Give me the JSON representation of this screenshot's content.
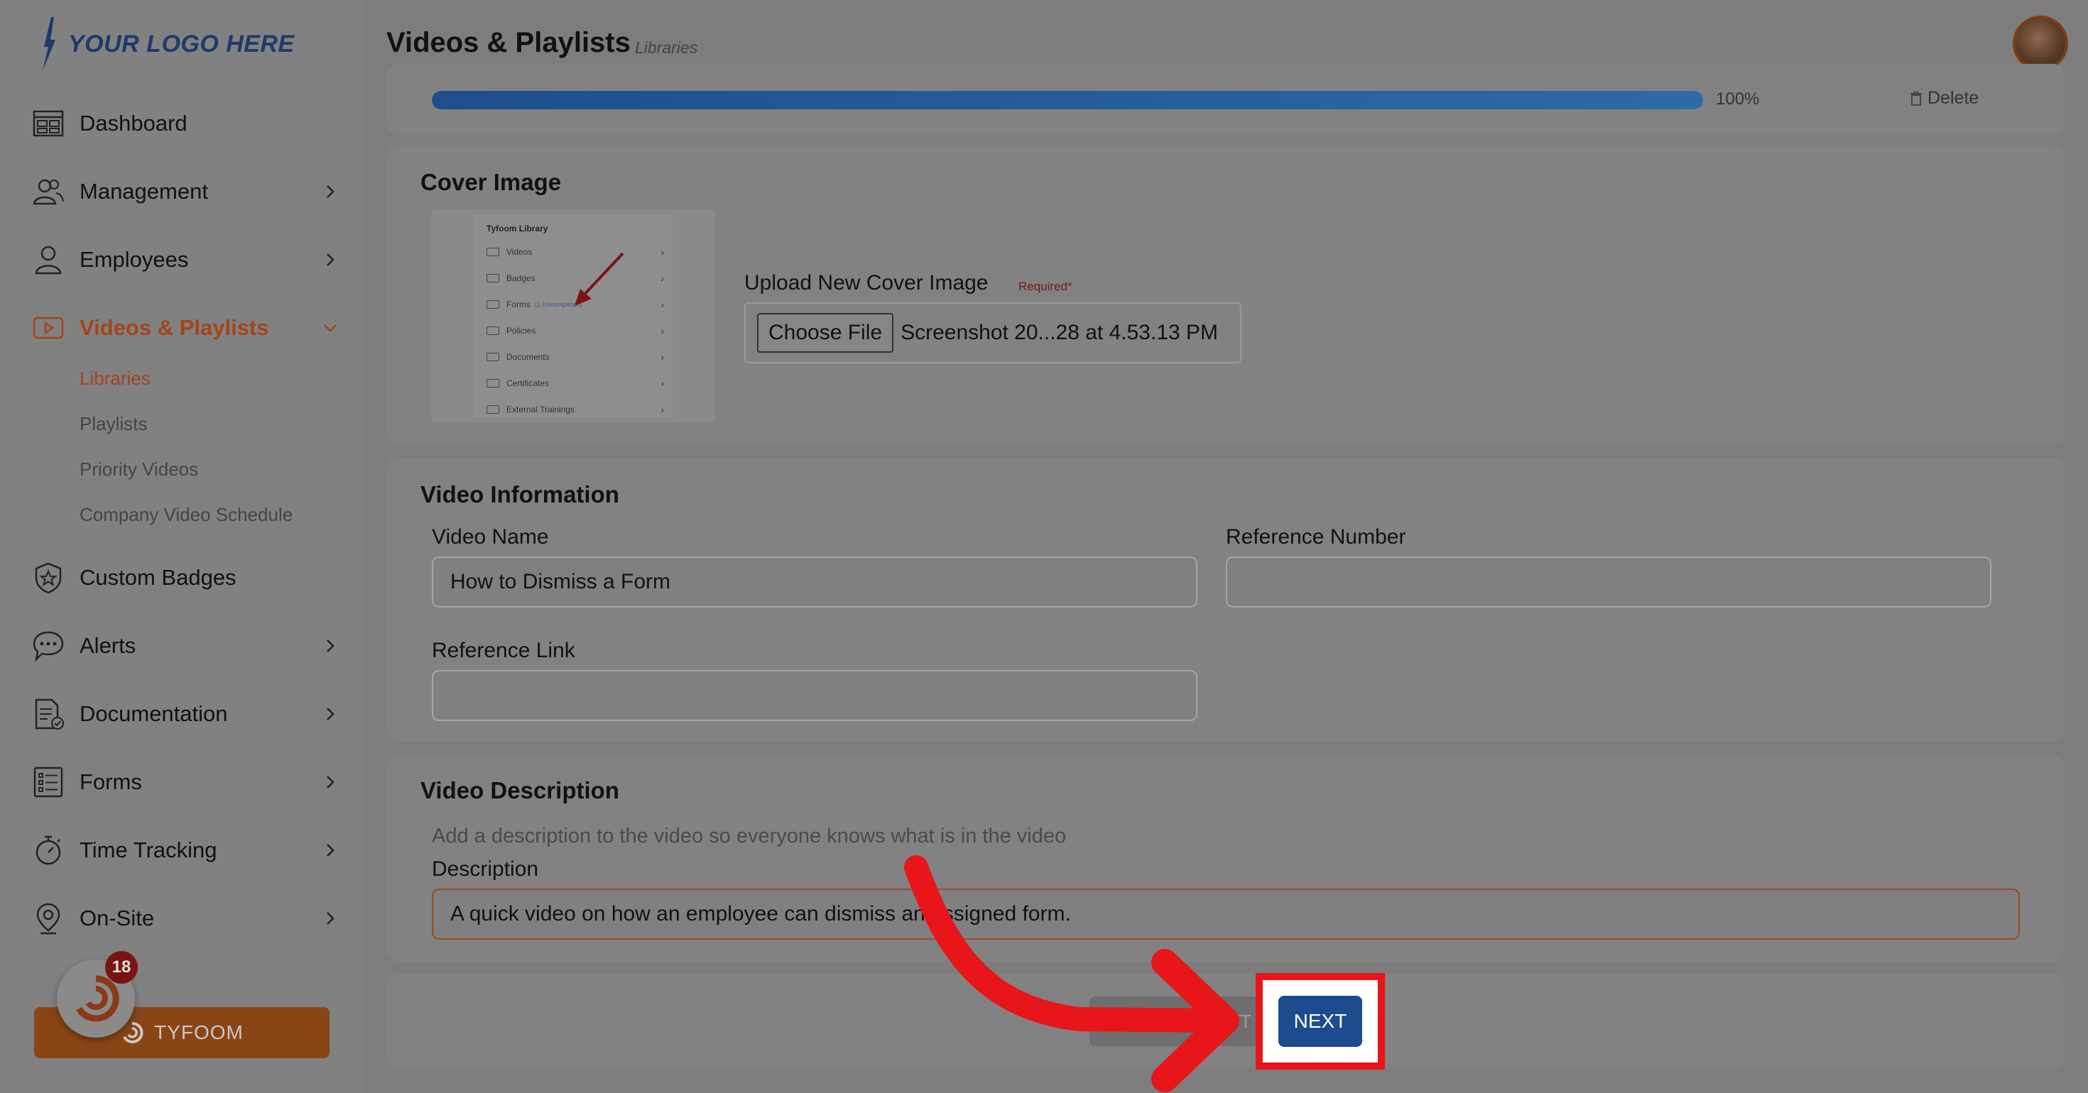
{
  "logo": {
    "text": "YOUR LOGO HERE"
  },
  "header": {
    "title": "Videos & Playlists",
    "breadcrumb": "Libraries"
  },
  "sidebar": {
    "items": [
      {
        "label": "Dashboard",
        "icon": "dashboard-icon",
        "chevron": false
      },
      {
        "label": "Management",
        "icon": "management-icon",
        "chevron": true
      },
      {
        "label": "Employees",
        "icon": "employees-icon",
        "chevron": true
      },
      {
        "label": "Videos & Playlists",
        "icon": "video-icon",
        "chevron": true,
        "active": true,
        "expanded": true
      },
      {
        "label": "Custom Badges",
        "icon": "badge-icon",
        "chevron": false
      },
      {
        "label": "Alerts",
        "icon": "alerts-icon",
        "chevron": true
      },
      {
        "label": "Documentation",
        "icon": "documentation-icon",
        "chevron": true
      },
      {
        "label": "Forms",
        "icon": "forms-icon",
        "chevron": true
      },
      {
        "label": "Time Tracking",
        "icon": "stopwatch-icon",
        "chevron": true
      },
      {
        "label": "On-Site",
        "icon": "location-pin-icon",
        "chevron": true
      }
    ],
    "subitems": [
      {
        "label": "Libraries",
        "active": true
      },
      {
        "label": "Playlists"
      },
      {
        "label": "Priority Videos"
      },
      {
        "label": "Company Video Schedule"
      }
    ],
    "tyfoom_button": "TYFOOM",
    "notification_count": "18"
  },
  "upload": {
    "progress_percent": 100,
    "progress_label": "100%",
    "delete_label": "Delete"
  },
  "cover_image": {
    "title": "Cover Image",
    "upload_label": "Upload New Cover Image",
    "required_label": "Required*",
    "choose_file_label": "Choose File",
    "file_name": "Screenshot 20...28 at 4.53.13 PM",
    "thumbnail": {
      "title": "Tyfoom Library",
      "rows": [
        "Videos",
        "Badges",
        "Forms",
        "Policies",
        "Documents",
        "Certificates",
        "External Trainings"
      ],
      "forms_note": "(1 Uncompleted)"
    }
  },
  "video_info": {
    "title": "Video Information",
    "name_label": "Video Name",
    "name_value": "How to Dismiss a Form",
    "ref_number_label": "Reference Number",
    "ref_number_value": "",
    "ref_link_label": "Reference Link",
    "ref_link_value": ""
  },
  "video_description": {
    "title": "Video Description",
    "help_text": "Add a description to the video so everyone knows what is in the video",
    "label": "Description",
    "value": "A quick video on how an employee can dismiss an assigned form."
  },
  "footer": {
    "prev_label": "LEFT",
    "next_label": "NEXT"
  },
  "colors": {
    "accent": "#a2451b",
    "primary_button": "#1e4b8f",
    "highlight": "#e8151b",
    "progress": "#2d6aa8"
  }
}
